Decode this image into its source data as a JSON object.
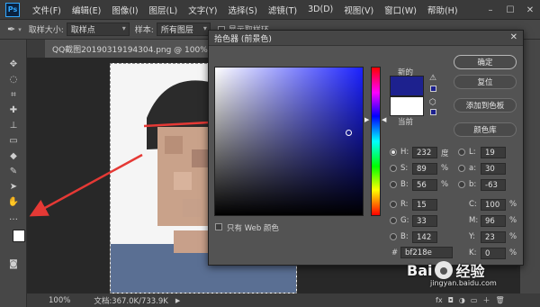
{
  "menu": [
    "文件(F)",
    "编辑(E)",
    "图像(I)",
    "图层(L)",
    "文字(Y)",
    "选择(S)",
    "滤镜(T)",
    "3D(D)",
    "视图(V)",
    "窗口(W)",
    "帮助(H)"
  ],
  "app_icon_label": "Ps",
  "options_bar": {
    "sample_size_label": "取样大小:",
    "sample_size_value": "取样点",
    "sample_label": "样本:",
    "sample_value": "所有图层",
    "show_ring_label": "显示取样环"
  },
  "document": {
    "tab_title": "QQ截图20190319194304.png @ 100% (图层 1 拷",
    "zoom": "100%",
    "doc_size": "文档:367.0K/733.9K"
  },
  "dialog": {
    "title": "拾色器 (前景色)",
    "new_label": "新的",
    "current_label": "当前",
    "buttons": {
      "ok": "确定",
      "reset": "复位",
      "add_to_swatches": "添加到色板",
      "color_libraries": "颜色库"
    },
    "only_web_colors": "只有 Web 颜色",
    "fields": {
      "H": {
        "label": "H:",
        "value": "232",
        "unit": "度"
      },
      "S": {
        "label": "S:",
        "value": "89",
        "unit": "%"
      },
      "B": {
        "label": "B:",
        "value": "56",
        "unit": "%"
      },
      "R": {
        "label": "R:",
        "value": "15"
      },
      "G": {
        "label": "G:",
        "value": "33"
      },
      "Bv": {
        "label": "B:",
        "value": "142"
      },
      "L": {
        "label": "L:",
        "value": "19"
      },
      "a": {
        "label": "a:",
        "value": "30"
      },
      "b": {
        "label": "b:",
        "value": "-63"
      },
      "C": {
        "label": "C:",
        "value": "100",
        "unit": "%"
      },
      "M": {
        "label": "M:",
        "value": "96",
        "unit": "%"
      },
      "Y": {
        "label": "Y:",
        "value": "23",
        "unit": "%"
      },
      "K": {
        "label": "K:",
        "value": "0",
        "unit": "%"
      }
    },
    "hex_label": "#",
    "hex_value": "bf218e"
  },
  "watermark": {
    "brand": "Bai",
    "brand_mid": "经验",
    "sub": "jingyan.baidu.com"
  },
  "colors": {
    "new_color": "#1d218e",
    "current_color": "#ffffff",
    "foreground": "#ffffff",
    "background_swatch": "#2a2aff",
    "arrow": "#e53935"
  }
}
